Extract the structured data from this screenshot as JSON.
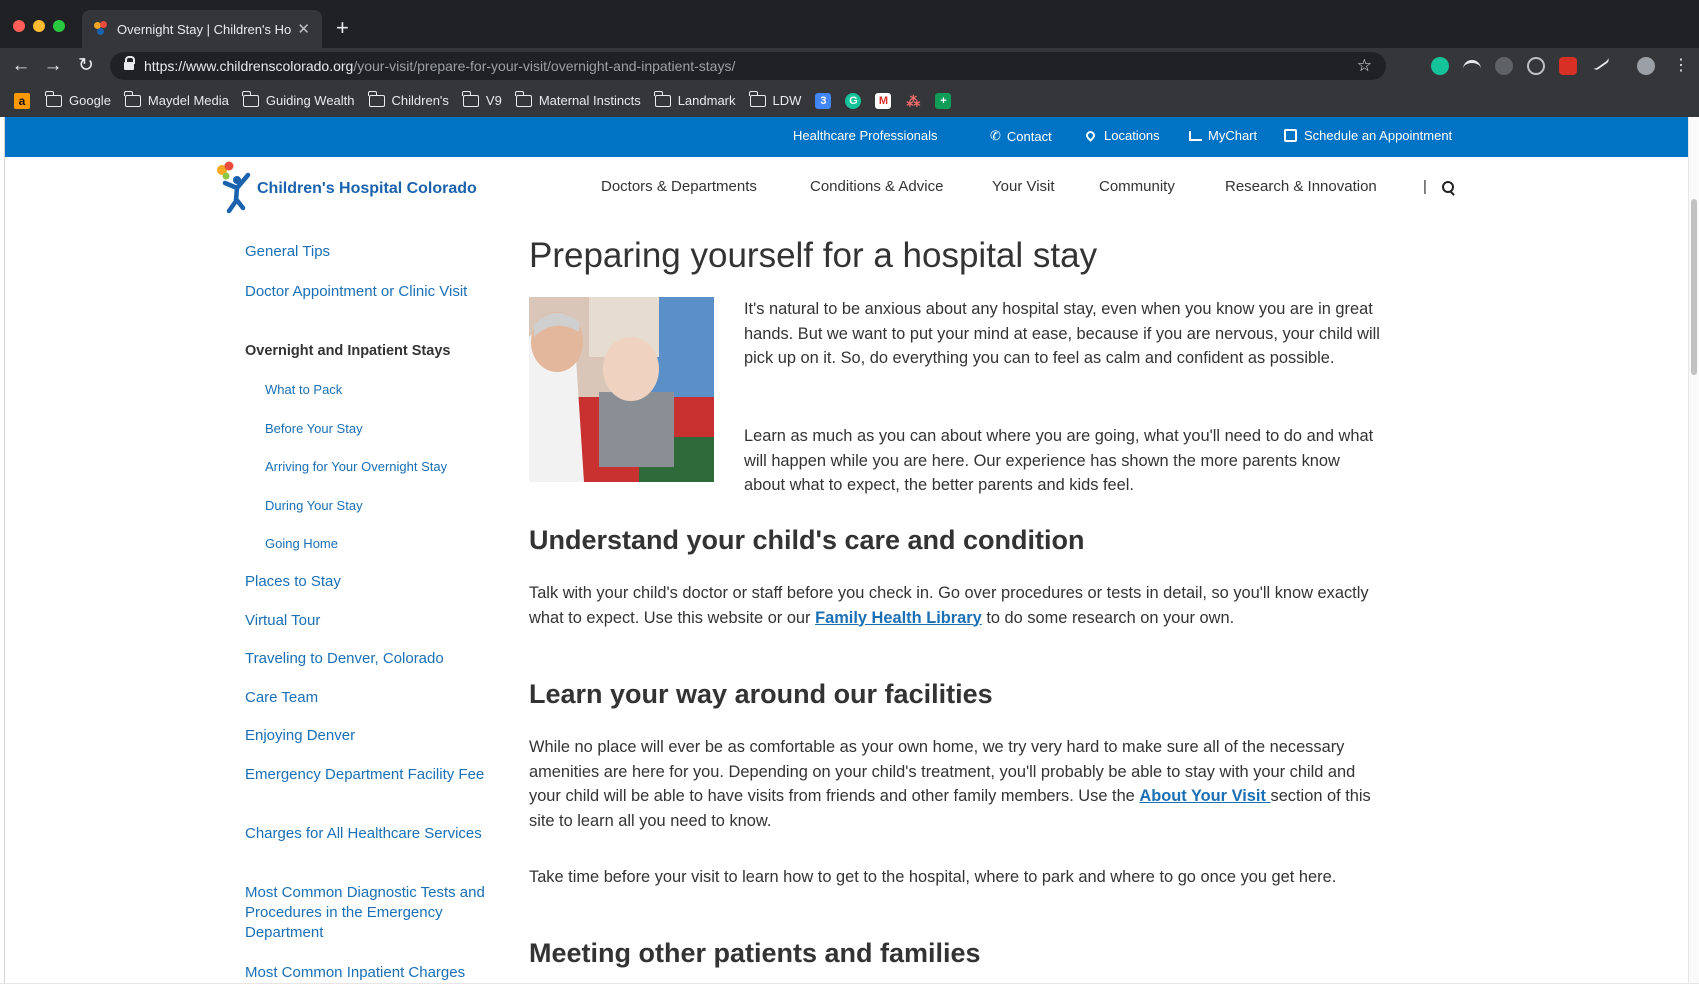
{
  "browser": {
    "tab_title": "Overnight Stay | Children's Hos",
    "url_host": "https://www.childrenscolorado.org",
    "url_path": "/your-visit/prepare-for-your-visit/overnight-and-inpatient-stays/",
    "bookmarks": [
      "Google",
      "Maydel Media",
      "Guiding Wealth",
      "Children's",
      "V9",
      "Maternal Instincts",
      "Landmark",
      "LDW"
    ]
  },
  "utility_nav": {
    "healthcare": "Healthcare Professionals",
    "contact": "Contact",
    "locations": "Locations",
    "mychart": "MyChart",
    "schedule": "Schedule an Appointment"
  },
  "header": {
    "logo_text": "Children's Hospital Colorado",
    "nav": [
      "Doctors & Departments",
      "Conditions & Advice",
      "Your Visit",
      "Community",
      "Research & Innovation"
    ],
    "separator": "|"
  },
  "sidebar": {
    "items": [
      "General Tips",
      "Doctor Appointment or Clinic Visit",
      "Overnight and Inpatient Stays",
      "What to Pack",
      "Before Your Stay",
      "Arriving for Your Overnight Stay",
      "During Your Stay",
      "Going Home",
      "Places to Stay",
      "Virtual Tour",
      "Traveling to Denver, Colorado",
      "Care Team",
      "Enjoying Denver",
      "Emergency Department Facility Fee",
      "Charges for All Healthcare Services",
      "Most Common Diagnostic Tests and Procedures in the Emergency Department",
      "Most Common Inpatient Charges"
    ]
  },
  "article": {
    "title": "Preparing yourself for a hospital stay",
    "intro_1": "It's natural to be anxious about any hospital stay, even when you know you are in great hands. But we want to put your mind at ease, because if you are nervous, your child will pick up on it. So, do everything you can to feel as calm and confident as possible.",
    "intro_2": "Learn as much as you can about where you are going, what you'll need to do and what will happen while you are here. Our experience has shown the more parents know about what to expect, the better parents and kids feel.",
    "h2_1": "Understand your child's care and condition",
    "p1_before": "Talk with your child's doctor or staff before you check in. Go over procedures or tests in detail, so you'll know exactly what to expect. Use this website or our ",
    "p1_link": "Family Health Library",
    "p1_after": " to do some research on your own.",
    "h2_2": "Learn your way around our facilities",
    "p2_before": "While no place will ever be as comfortable as your own home, we try very hard to make sure all of the necessary amenities are here for you. Depending on your child's treatment, you'll probably be able to stay with your child and your child will be able to have visits from friends and other family members. Use the ",
    "p2_link": "About Your Visit ",
    "p2_after": "section of this site to learn all you need to know.",
    "p3": "Take time before your visit to learn how to get to the hospital, where to park and where to go once you get here.",
    "h2_3": "Meeting other patients and families"
  },
  "colors": {
    "utility_bar": "#0073c4",
    "link": "#1a6fb5",
    "logo_blue": "#1a62ad",
    "text": "#333333"
  }
}
